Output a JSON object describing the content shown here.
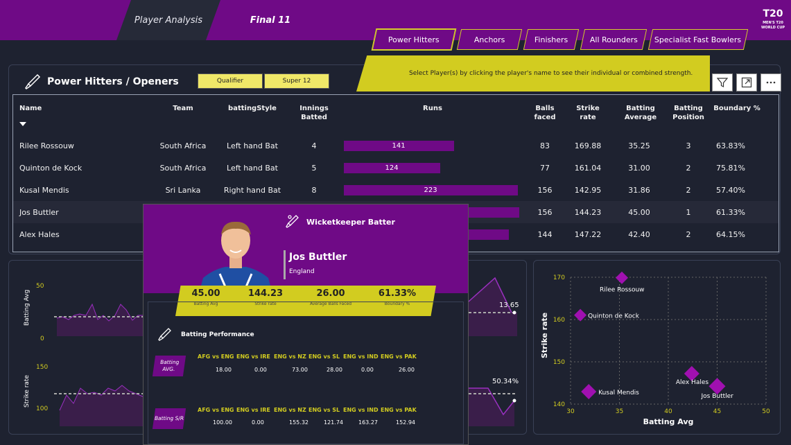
{
  "tabs": {
    "active": "Player Analysis",
    "second": "Final 11"
  },
  "logo": {
    "text": "T20 MEN'S T20 WORLD CUP"
  },
  "segments": [
    "Power Hitters",
    "Anchors",
    "Finishers",
    "All Rounders",
    "Specialist Fast Bowlers"
  ],
  "banner": "Select Player(s) by clicking the player's name to see their individual or combined strength.",
  "panel": {
    "title": "Power Hitters / Openers",
    "filters": [
      "Qualifier",
      "Super 12"
    ]
  },
  "icons": {
    "filter": "filter-icon",
    "expand": "expand-icon",
    "more": "more-icon",
    "bat": "cricket-bat-icon"
  },
  "table": {
    "headers": {
      "name": "Name",
      "team": "Team",
      "style": "battingStyle",
      "innings": "Innings Batted",
      "runs": "Runs",
      "balls": "Balls faced",
      "sr": "Strike rate",
      "avg": "Batting Average",
      "pos": "Batting Position",
      "bnd": "Boundary %"
    },
    "rows": [
      {
        "name": "Rilee Rossouw",
        "team": "South Africa",
        "style": "Left hand Bat",
        "innings": "4",
        "runs": 141,
        "balls": "83",
        "sr": "169.88",
        "avg": "35.25",
        "pos": "3",
        "bnd": "63.83%"
      },
      {
        "name": "Quinton de Kock",
        "team": "South Africa",
        "style": "Left hand Bat",
        "innings": "5",
        "runs": 124,
        "balls": "77",
        "sr": "161.04",
        "avg": "31.00",
        "pos": "2",
        "bnd": "75.81%"
      },
      {
        "name": "Kusal Mendis",
        "team": "Sri Lanka",
        "style": "Right hand Bat",
        "innings": "8",
        "runs": 223,
        "balls": "156",
        "sr": "142.95",
        "avg": "31.86",
        "pos": "2",
        "bnd": "57.40%"
      },
      {
        "name": "Jos Buttler",
        "team": "",
        "style": "",
        "innings": "",
        "runs": 225,
        "balls": "156",
        "sr": "144.23",
        "avg": "45.00",
        "pos": "1",
        "bnd": "61.33%"
      },
      {
        "name": "Alex Hales",
        "team": "",
        "style": "",
        "innings": "",
        "runs": 212,
        "balls": "144",
        "sr": "147.22",
        "avg": "42.40",
        "pos": "2",
        "bnd": "64.15%"
      }
    ],
    "max_runs": 225
  },
  "left_chart": {
    "avg_label": "Batting Avg",
    "sr_label": "Strike rate",
    "avg_ticks": [
      "50",
      "0"
    ],
    "sr_ticks": [
      "150",
      "100"
    ],
    "avg_value": "13.65",
    "sr_value": "50.34%"
  },
  "tooltip": {
    "role": "Wicketkeeper Batter",
    "player": "Jos Buttler",
    "country": "England",
    "stats": [
      {
        "value": "45.00",
        "label": "Batting Avg"
      },
      {
        "value": "144.23",
        "label": "Strike rate"
      },
      {
        "value": "26.00",
        "label": "Average Balls Faced"
      },
      {
        "value": "61.33%",
        "label": "Boundary %"
      }
    ],
    "perf_title": "Batting Performance",
    "avg_tag": "Batting AVG.",
    "sr_tag": "Batting S/R",
    "avg_matches": [
      "AFG vs ENG",
      "ENG vs IRE",
      "ENG vs NZ",
      "ENG vs SL",
      "ENG vs IND",
      "ENG vs PAK"
    ],
    "avg_values": [
      "18.00",
      "0.00",
      "73.00",
      "28.00",
      "0.00",
      "26.00"
    ],
    "sr_matches": [
      "AFG vs ENG",
      "ENG vs IRE",
      "ENG vs NZ",
      "ENG vs SL",
      "ENG vs IND",
      "ENG vs PAK"
    ],
    "sr_values": [
      "100.00",
      "0.00",
      "155.32",
      "121.74",
      "163.27",
      "152.94"
    ]
  },
  "scatter": {
    "xlabel": "Batting Avg",
    "ylabel": "Strike rate",
    "xticks": [
      "30",
      "35",
      "40",
      "45",
      "50"
    ],
    "yticks": [
      "170",
      "160",
      "150",
      "140"
    ]
  },
  "chart_data": {
    "type": "scatter",
    "xlabel": "Batting Avg",
    "ylabel": "Strike rate",
    "xlim": [
      30,
      50
    ],
    "ylim": [
      140,
      170
    ],
    "points": [
      {
        "label": "Rilee Rossouw",
        "x": 35.25,
        "y": 169.88
      },
      {
        "label": "Quinton de Kock",
        "x": 31.0,
        "y": 161.04
      },
      {
        "label": "Kusal Mendis",
        "x": 31.86,
        "y": 142.95
      },
      {
        "label": "Alex Hales",
        "x": 42.4,
        "y": 147.22
      },
      {
        "label": "Jos Buttler",
        "x": 45.0,
        "y": 144.23
      }
    ],
    "marker_color": "#a010b0"
  }
}
